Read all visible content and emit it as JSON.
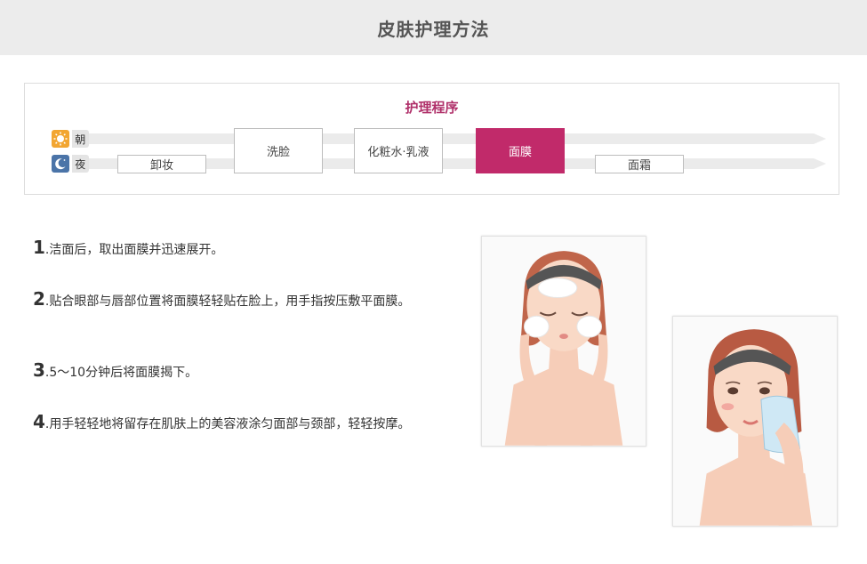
{
  "header": {
    "title": "皮肤护理方法"
  },
  "routine": {
    "title": "护理程序",
    "morning_label": "朝",
    "night_label": "夜",
    "morning_icon": "sun-icon",
    "night_icon": "moon-icon",
    "steps": [
      {
        "label": "卸妆"
      },
      {
        "label": "洗脸"
      },
      {
        "label": "化粧水·乳液"
      },
      {
        "label": "面膜"
      },
      {
        "label": "面霜"
      }
    ],
    "active_color": "#c12a6a"
  },
  "instructions": [
    {
      "num": "1",
      "text": ".洁面后，取出面膜并迅速展开。"
    },
    {
      "num": "2",
      "text": ".贴合眼部与唇部位置将面膜轻轻贴在脸上，用手指按压敷平面膜。"
    },
    {
      "num": "3",
      "text": ".5～10分钟后将面膜揭下。"
    },
    {
      "num": "4",
      "text": ".用手轻轻地将留存在肌肤上的美容液涂匀面部与颈部，轻轻按摩。"
    }
  ]
}
